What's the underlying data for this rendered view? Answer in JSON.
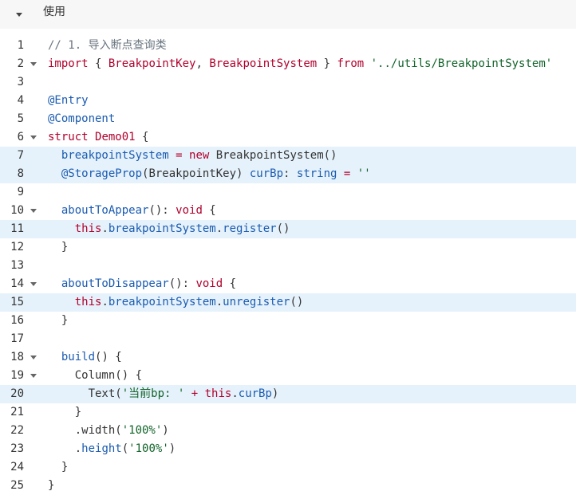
{
  "header": {
    "title": "使用"
  },
  "code": {
    "lines": [
      {
        "n": "1",
        "fold": false,
        "hl": false,
        "tokens": [
          {
            "t": "// 1. 导入断点查询类",
            "c": "cm"
          }
        ]
      },
      {
        "n": "2",
        "fold": true,
        "hl": false,
        "tokens": [
          {
            "t": "import",
            "c": "kw"
          },
          {
            "t": " { ",
            "c": "tx"
          },
          {
            "t": "BreakpointKey",
            "c": "kw"
          },
          {
            "t": ", ",
            "c": "tx"
          },
          {
            "t": "BreakpointSystem",
            "c": "kw"
          },
          {
            "t": " } ",
            "c": "tx"
          },
          {
            "t": "from",
            "c": "kw"
          },
          {
            "t": " ",
            "c": "tx"
          },
          {
            "t": "'../utils/BreakpointSystem'",
            "c": "st"
          }
        ]
      },
      {
        "n": "3",
        "fold": false,
        "hl": false,
        "tokens": []
      },
      {
        "n": "4",
        "fold": false,
        "hl": false,
        "tokens": [
          {
            "t": "@Entry",
            "c": "fn"
          }
        ]
      },
      {
        "n": "5",
        "fold": false,
        "hl": false,
        "tokens": [
          {
            "t": "@Component",
            "c": "fn"
          }
        ]
      },
      {
        "n": "6",
        "fold": true,
        "hl": false,
        "tokens": [
          {
            "t": "struct",
            "c": "kw"
          },
          {
            "t": " ",
            "c": "tx"
          },
          {
            "t": "Demo01",
            "c": "kw"
          },
          {
            "t": " {",
            "c": "tx"
          }
        ]
      },
      {
        "n": "7",
        "fold": false,
        "hl": true,
        "tokens": [
          {
            "t": "  ",
            "c": "tx"
          },
          {
            "t": "breakpointSystem",
            "c": "fn"
          },
          {
            "t": " ",
            "c": "tx"
          },
          {
            "t": "=",
            "c": "kw"
          },
          {
            "t": " ",
            "c": "tx"
          },
          {
            "t": "new",
            "c": "kw"
          },
          {
            "t": " BreakpointSystem()",
            "c": "tx"
          }
        ]
      },
      {
        "n": "8",
        "fold": false,
        "hl": true,
        "tokens": [
          {
            "t": "  ",
            "c": "tx"
          },
          {
            "t": "@StorageProp",
            "c": "fn"
          },
          {
            "t": "(BreakpointKey) ",
            "c": "tx"
          },
          {
            "t": "curBp",
            "c": "fn"
          },
          {
            "t": ": ",
            "c": "tx"
          },
          {
            "t": "string",
            "c": "fn"
          },
          {
            "t": " ",
            "c": "tx"
          },
          {
            "t": "=",
            "c": "kw"
          },
          {
            "t": " ",
            "c": "tx"
          },
          {
            "t": "''",
            "c": "st"
          }
        ]
      },
      {
        "n": "9",
        "fold": false,
        "hl": false,
        "tokens": []
      },
      {
        "n": "10",
        "fold": true,
        "hl": false,
        "tokens": [
          {
            "t": "  ",
            "c": "tx"
          },
          {
            "t": "aboutToAppear",
            "c": "fn"
          },
          {
            "t": "(): ",
            "c": "tx"
          },
          {
            "t": "void",
            "c": "kw"
          },
          {
            "t": " {",
            "c": "tx"
          }
        ]
      },
      {
        "n": "11",
        "fold": false,
        "hl": true,
        "tokens": [
          {
            "t": "    ",
            "c": "tx"
          },
          {
            "t": "this",
            "c": "kw"
          },
          {
            "t": ".",
            "c": "tx"
          },
          {
            "t": "breakpointSystem",
            "c": "fn"
          },
          {
            "t": ".",
            "c": "tx"
          },
          {
            "t": "register",
            "c": "fn"
          },
          {
            "t": "()",
            "c": "tx"
          }
        ]
      },
      {
        "n": "12",
        "fold": false,
        "hl": false,
        "tokens": [
          {
            "t": "  }",
            "c": "tx"
          }
        ]
      },
      {
        "n": "13",
        "fold": false,
        "hl": false,
        "tokens": []
      },
      {
        "n": "14",
        "fold": true,
        "hl": false,
        "tokens": [
          {
            "t": "  ",
            "c": "tx"
          },
          {
            "t": "aboutToDisappear",
            "c": "fn"
          },
          {
            "t": "(): ",
            "c": "tx"
          },
          {
            "t": "void",
            "c": "kw"
          },
          {
            "t": " {",
            "c": "tx"
          }
        ]
      },
      {
        "n": "15",
        "fold": false,
        "hl": true,
        "tokens": [
          {
            "t": "    ",
            "c": "tx"
          },
          {
            "t": "this",
            "c": "kw"
          },
          {
            "t": ".",
            "c": "tx"
          },
          {
            "t": "breakpointSystem",
            "c": "fn"
          },
          {
            "t": ".",
            "c": "tx"
          },
          {
            "t": "unregister",
            "c": "fn"
          },
          {
            "t": "()",
            "c": "tx"
          }
        ]
      },
      {
        "n": "16",
        "fold": false,
        "hl": false,
        "tokens": [
          {
            "t": "  }",
            "c": "tx"
          }
        ]
      },
      {
        "n": "17",
        "fold": false,
        "hl": false,
        "tokens": []
      },
      {
        "n": "18",
        "fold": true,
        "hl": false,
        "tokens": [
          {
            "t": "  ",
            "c": "tx"
          },
          {
            "t": "build",
            "c": "fn"
          },
          {
            "t": "() {",
            "c": "tx"
          }
        ]
      },
      {
        "n": "19",
        "fold": true,
        "hl": false,
        "tokens": [
          {
            "t": "    Column() {",
            "c": "tx"
          }
        ]
      },
      {
        "n": "20",
        "fold": false,
        "hl": true,
        "tokens": [
          {
            "t": "      Text(",
            "c": "tx"
          },
          {
            "t": "'当前bp: '",
            "c": "st"
          },
          {
            "t": " ",
            "c": "tx"
          },
          {
            "t": "+",
            "c": "kw"
          },
          {
            "t": " ",
            "c": "tx"
          },
          {
            "t": "this",
            "c": "kw"
          },
          {
            "t": ".",
            "c": "tx"
          },
          {
            "t": "curBp",
            "c": "fn"
          },
          {
            "t": ")",
            "c": "tx"
          }
        ]
      },
      {
        "n": "21",
        "fold": false,
        "hl": false,
        "tokens": [
          {
            "t": "    }",
            "c": "tx"
          }
        ]
      },
      {
        "n": "22",
        "fold": false,
        "hl": false,
        "tokens": [
          {
            "t": "    .width(",
            "c": "tx"
          },
          {
            "t": "'100%'",
            "c": "st"
          },
          {
            "t": ")",
            "c": "tx"
          }
        ]
      },
      {
        "n": "23",
        "fold": false,
        "hl": false,
        "tokens": [
          {
            "t": "    .",
            "c": "tx"
          },
          {
            "t": "height",
            "c": "fn"
          },
          {
            "t": "(",
            "c": "tx"
          },
          {
            "t": "'100%'",
            "c": "st"
          },
          {
            "t": ")",
            "c": "tx"
          }
        ]
      },
      {
        "n": "24",
        "fold": false,
        "hl": false,
        "tokens": [
          {
            "t": "  }",
            "c": "tx"
          }
        ]
      },
      {
        "n": "25",
        "fold": false,
        "hl": false,
        "tokens": [
          {
            "t": "}",
            "c": "tx"
          }
        ]
      }
    ]
  },
  "colors": {
    "keyword": "#b1002b",
    "identifier": "#1a5bb1",
    "string": "#116329",
    "comment": "#6a7580",
    "highlight": "#e6f2fb",
    "header_bg": "#f7f7f7"
  },
  "icons": {
    "toggle": "chevron-down-icon",
    "fold": "fold-arrow-icon"
  }
}
